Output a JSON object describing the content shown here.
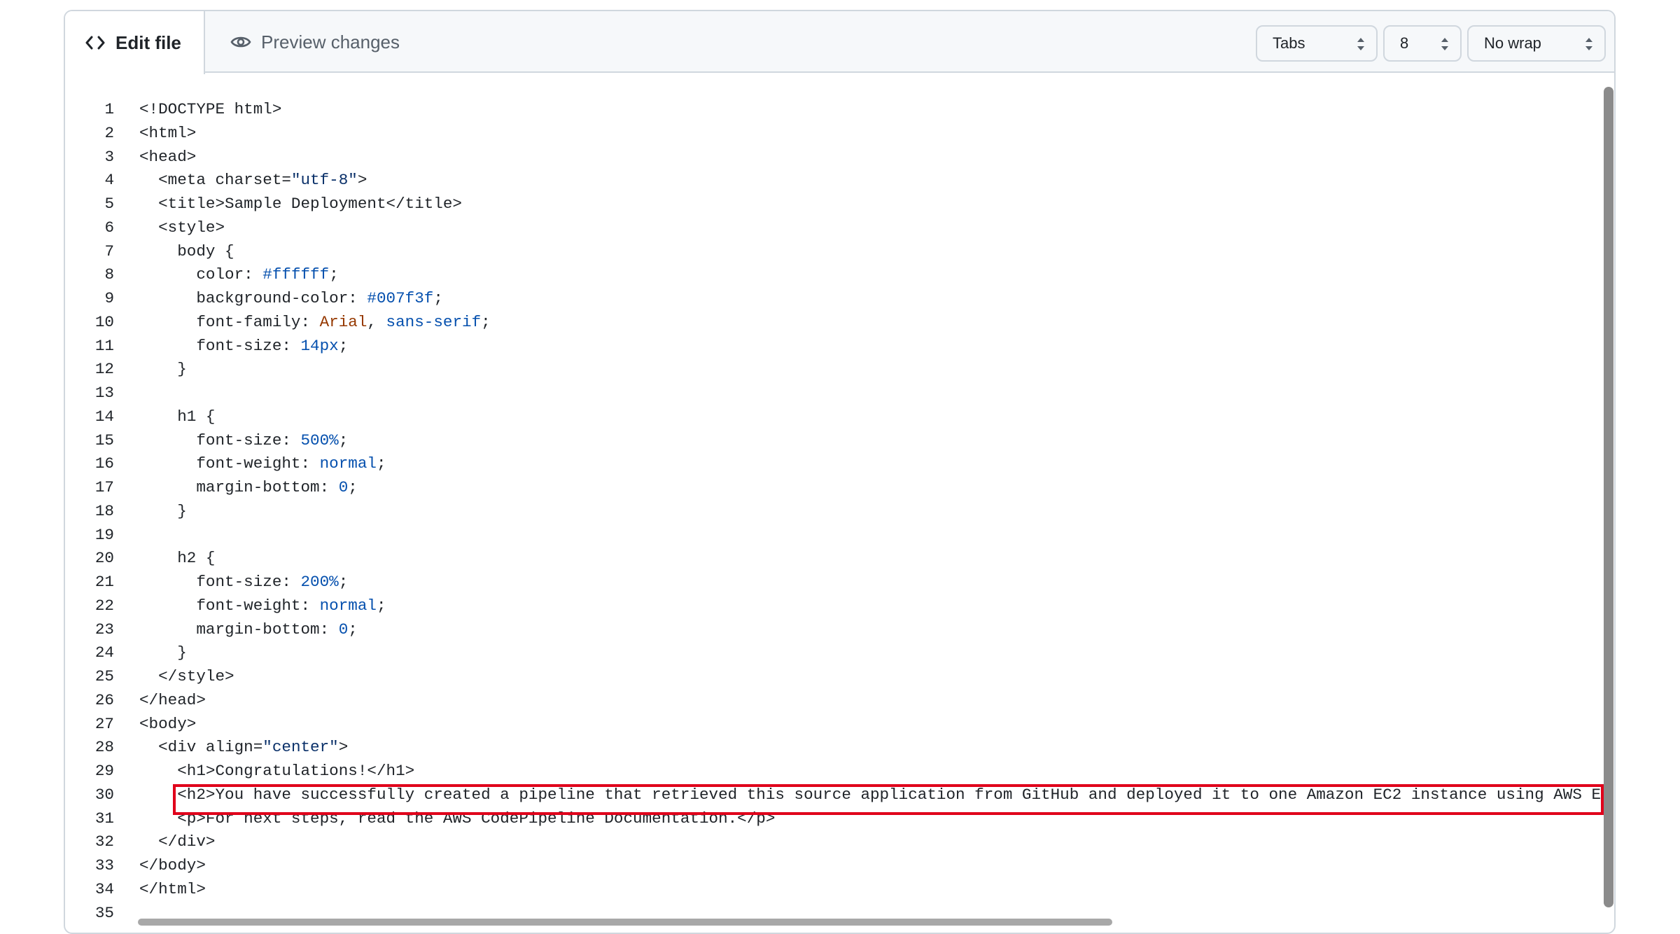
{
  "tabs": {
    "edit": "Edit file",
    "preview": "Preview changes"
  },
  "controls": {
    "indent_mode": "Tabs",
    "indent_size": "8",
    "wrap_mode": "No wrap"
  },
  "editor": {
    "lines": [
      {
        "n": "1",
        "segs": [
          {
            "t": "<!DOCTYPE html>"
          }
        ]
      },
      {
        "n": "2",
        "segs": [
          {
            "t": "<html>"
          }
        ]
      },
      {
        "n": "3",
        "segs": [
          {
            "t": "<head>"
          }
        ]
      },
      {
        "n": "4",
        "segs": [
          {
            "t": "  <meta charset="
          },
          {
            "t": "\"utf-8\"",
            "c": "str"
          },
          {
            "t": ">"
          }
        ]
      },
      {
        "n": "5",
        "segs": [
          {
            "t": "  <title>Sample Deployment</title>"
          }
        ]
      },
      {
        "n": "6",
        "segs": [
          {
            "t": "  <style>"
          }
        ]
      },
      {
        "n": "7",
        "segs": [
          {
            "t": "    body {"
          }
        ]
      },
      {
        "n": "8",
        "segs": [
          {
            "t": "      color: "
          },
          {
            "t": "#ffffff",
            "c": "blue"
          },
          {
            "t": ";"
          }
        ]
      },
      {
        "n": "9",
        "segs": [
          {
            "t": "      background-color: "
          },
          {
            "t": "#007f3f",
            "c": "blue"
          },
          {
            "t": ";"
          }
        ]
      },
      {
        "n": "10",
        "segs": [
          {
            "t": "      font-family: "
          },
          {
            "t": "Arial",
            "c": "orange"
          },
          {
            "t": ", "
          },
          {
            "t": "sans-serif",
            "c": "blue"
          },
          {
            "t": ";"
          }
        ]
      },
      {
        "n": "11",
        "segs": [
          {
            "t": "      font-size: "
          },
          {
            "t": "14px",
            "c": "blue"
          },
          {
            "t": ";"
          }
        ]
      },
      {
        "n": "12",
        "segs": [
          {
            "t": "    }"
          }
        ]
      },
      {
        "n": "13",
        "segs": [
          {
            "t": ""
          }
        ]
      },
      {
        "n": "14",
        "segs": [
          {
            "t": "    h1 {"
          }
        ]
      },
      {
        "n": "15",
        "segs": [
          {
            "t": "      font-size: "
          },
          {
            "t": "500%",
            "c": "blue"
          },
          {
            "t": ";"
          }
        ]
      },
      {
        "n": "16",
        "segs": [
          {
            "t": "      font-weight: "
          },
          {
            "t": "normal",
            "c": "blue"
          },
          {
            "t": ";"
          }
        ]
      },
      {
        "n": "17",
        "segs": [
          {
            "t": "      margin-bottom: "
          },
          {
            "t": "0",
            "c": "blue"
          },
          {
            "t": ";"
          }
        ]
      },
      {
        "n": "18",
        "segs": [
          {
            "t": "    }"
          }
        ]
      },
      {
        "n": "19",
        "segs": [
          {
            "t": ""
          }
        ]
      },
      {
        "n": "20",
        "segs": [
          {
            "t": "    h2 {"
          }
        ]
      },
      {
        "n": "21",
        "segs": [
          {
            "t": "      font-size: "
          },
          {
            "t": "200%",
            "c": "blue"
          },
          {
            "t": ";"
          }
        ]
      },
      {
        "n": "22",
        "segs": [
          {
            "t": "      font-weight: "
          },
          {
            "t": "normal",
            "c": "blue"
          },
          {
            "t": ";"
          }
        ]
      },
      {
        "n": "23",
        "segs": [
          {
            "t": "      margin-bottom: "
          },
          {
            "t": "0",
            "c": "blue"
          },
          {
            "t": ";"
          }
        ]
      },
      {
        "n": "24",
        "segs": [
          {
            "t": "    }"
          }
        ]
      },
      {
        "n": "25",
        "segs": [
          {
            "t": "  </style>"
          }
        ]
      },
      {
        "n": "26",
        "segs": [
          {
            "t": "</head>"
          }
        ]
      },
      {
        "n": "27",
        "segs": [
          {
            "t": "<body>"
          }
        ]
      },
      {
        "n": "28",
        "segs": [
          {
            "t": "  <div align="
          },
          {
            "t": "\"center\"",
            "c": "str"
          },
          {
            "t": ">"
          }
        ]
      },
      {
        "n": "29",
        "segs": [
          {
            "t": "    <h1>Congratulations!</h1>"
          }
        ]
      },
      {
        "n": "30",
        "segs": [
          {
            "t": "    <h2>You have successfully created a pipeline that retrieved this source application from GitHub and deployed it to one Amazon EC2 instance using AWS E"
          }
        ]
      },
      {
        "n": "31",
        "segs": [
          {
            "t": "    <p>For next steps, read the AWS CodePipeline Documentation.</p>"
          }
        ]
      },
      {
        "n": "32",
        "segs": [
          {
            "t": "  </div>"
          }
        ]
      },
      {
        "n": "33",
        "segs": [
          {
            "t": "</body>"
          }
        ]
      },
      {
        "n": "34",
        "segs": [
          {
            "t": "</html>"
          }
        ]
      },
      {
        "n": "35",
        "segs": [
          {
            "t": ""
          }
        ]
      }
    ]
  }
}
